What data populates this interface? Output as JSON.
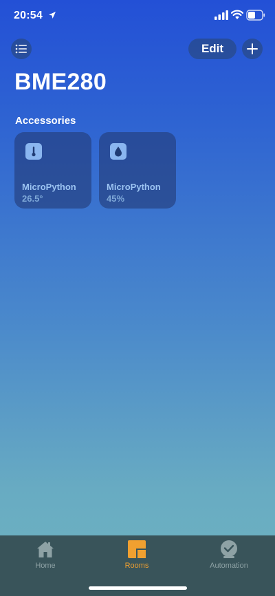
{
  "status_bar": {
    "time": "20:54",
    "icons": [
      "location-arrow-icon",
      "cellular-signal-icon",
      "wifi-icon",
      "battery-icon"
    ]
  },
  "toolbar": {
    "menu_icon": "list-icon",
    "edit_label": "Edit",
    "add_icon": "plus-icon"
  },
  "page": {
    "title": "BME280",
    "section_title": "Accessories"
  },
  "accessories": [
    {
      "icon": "thermometer-icon",
      "name": "MicroPython",
      "value": "26.5°"
    },
    {
      "icon": "water-drop-icon",
      "name": "MicroPython",
      "value": "45%"
    }
  ],
  "tab_bar": {
    "active": "Rooms",
    "tabs": [
      {
        "label": "Home",
        "icon": "home-icon"
      },
      {
        "label": "Rooms",
        "icon": "rooms-icon"
      },
      {
        "label": "Automation",
        "icon": "automation-icon"
      }
    ]
  },
  "colors": {
    "gradient_top": "#2350d6",
    "gradient_bottom": "#6fb4c0",
    "tile_bg": "#233c78",
    "tab_bar_bg": "#39545a",
    "active_tab": "#f0a030"
  }
}
